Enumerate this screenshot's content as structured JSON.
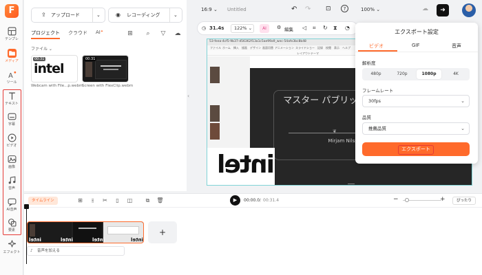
{
  "sidebar": {
    "logo": "F",
    "items": [
      {
        "label": "テンプレ"
      },
      {
        "label": "メディア"
      },
      {
        "label": "ツール"
      },
      {
        "label": "テキスト"
      },
      {
        "label": "字幕"
      },
      {
        "label": "ビデオ"
      },
      {
        "label": "画像"
      },
      {
        "label": "音声"
      },
      {
        "label": "AI音声"
      },
      {
        "label": "要素"
      },
      {
        "label": "エフェクト"
      }
    ]
  },
  "assets": {
    "upload_label": "アップロード",
    "record_label": "レコーディング",
    "tabs": [
      "プロジェクト",
      "クラウド",
      "AI"
    ],
    "filter_label": "ファイル",
    "thumbnails": [
      {
        "duration": "00:31",
        "caption": "Webcam with File...p.webm",
        "logo": "intel"
      },
      {
        "duration": "00:31",
        "caption": "Screen with FlexClip.webm"
      }
    ]
  },
  "topbar": {
    "aspect": "16:9",
    "title": "Untitled",
    "zoom": "100%"
  },
  "canvas_toolbar": {
    "duration": "31.4s",
    "scale": "122%",
    "ai_label": "AI",
    "edit_label": "編集"
  },
  "canvas": {
    "tab_title": "53-feea-4cf5-9b37-d56362f13a1c5ae99a9_wec-54afe3bc8b48",
    "slide_title": "マスター パブリック スピ ング",
    "presenter": "Mirjam Nilsson",
    "overlay_logo": "intel",
    "menu": [
      "ファイル",
      "ホーム",
      "挿入",
      "描画",
      "デザイン",
      "画面切替",
      "アニメーション",
      "スライドショー",
      "記録",
      "校閲",
      "表示",
      "ヘルプ"
    ],
    "toolbar_labels": [
      "レイアウト",
      "テーマ"
    ]
  },
  "export_panel": {
    "title": "エクスポート設定",
    "tabs": [
      "ビデオ",
      "GIF",
      "音声"
    ],
    "resolution_label": "解析度",
    "resolutions": [
      "480p",
      "720p",
      "1080p",
      "4K"
    ],
    "selected_resolution": "1080p",
    "framerate_label": "フレームレート",
    "framerate_value": "30fps",
    "quality_label": "品質",
    "quality_value": "推薦品質",
    "export_button": "エクスポート"
  },
  "timeline": {
    "chip_label": "タイムライン",
    "current_time": "00:00.0",
    "total_time": "00:31.4",
    "fit_label": "ぴったり",
    "add_audio": "音声を加える",
    "clip_logo": "intel"
  },
  "colors": {
    "accent": "#ff6a2b",
    "highlight": "#e53935",
    "canvas_border": "#7fd3d6"
  }
}
